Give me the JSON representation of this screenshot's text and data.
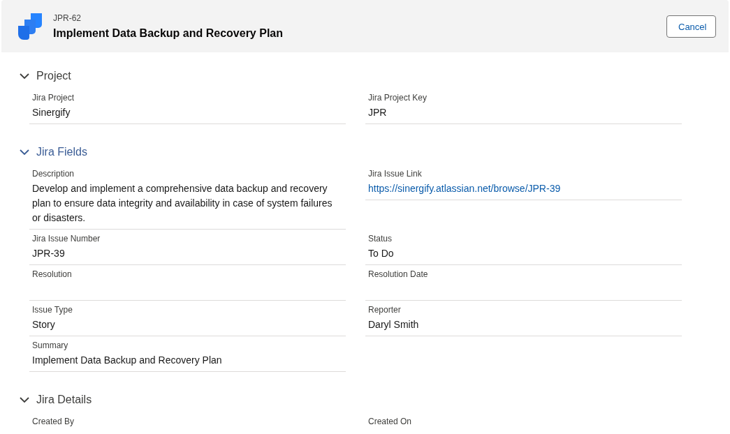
{
  "header": {
    "issue_key": "JPR-62",
    "title": "Implement Data Backup and Recovery Plan",
    "cancel_button": "Cancel"
  },
  "sections": [
    {
      "title": "Project",
      "expanded": true,
      "focused": false,
      "fields": [
        {
          "label": "Jira Project",
          "value": "Sinergify"
        },
        {
          "label": "Jira Project Key",
          "value": "JPR"
        }
      ]
    },
    {
      "title": "Jira Fields",
      "expanded": true,
      "focused": true,
      "fields": [
        {
          "label": "Description",
          "value": "Develop and implement a comprehensive data backup and recovery plan to ensure data integrity and availability in case of system failures or disasters."
        },
        {
          "label": "Jira Issue Link",
          "value": "https://sinergify.atlassian.net/browse/JPR-39",
          "kind": "link"
        },
        {
          "label": "Jira Issue Number",
          "value": "JPR-39"
        },
        {
          "label": "Status",
          "value": "To Do"
        },
        {
          "label": "Resolution"
        },
        {
          "label": "Resolution Date"
        },
        {
          "label": "Issue Type",
          "value": "Story"
        },
        {
          "label": "Reporter",
          "value": "Daryl Smith"
        },
        {
          "label": "Summary",
          "value": "Implement Data Backup and Recovery Plan"
        }
      ]
    },
    {
      "title": "Jira Details",
      "expanded": true,
      "focused": false,
      "fields": [
        {
          "label": "Created By"
        },
        {
          "label": "Created On"
        }
      ]
    }
  ]
}
